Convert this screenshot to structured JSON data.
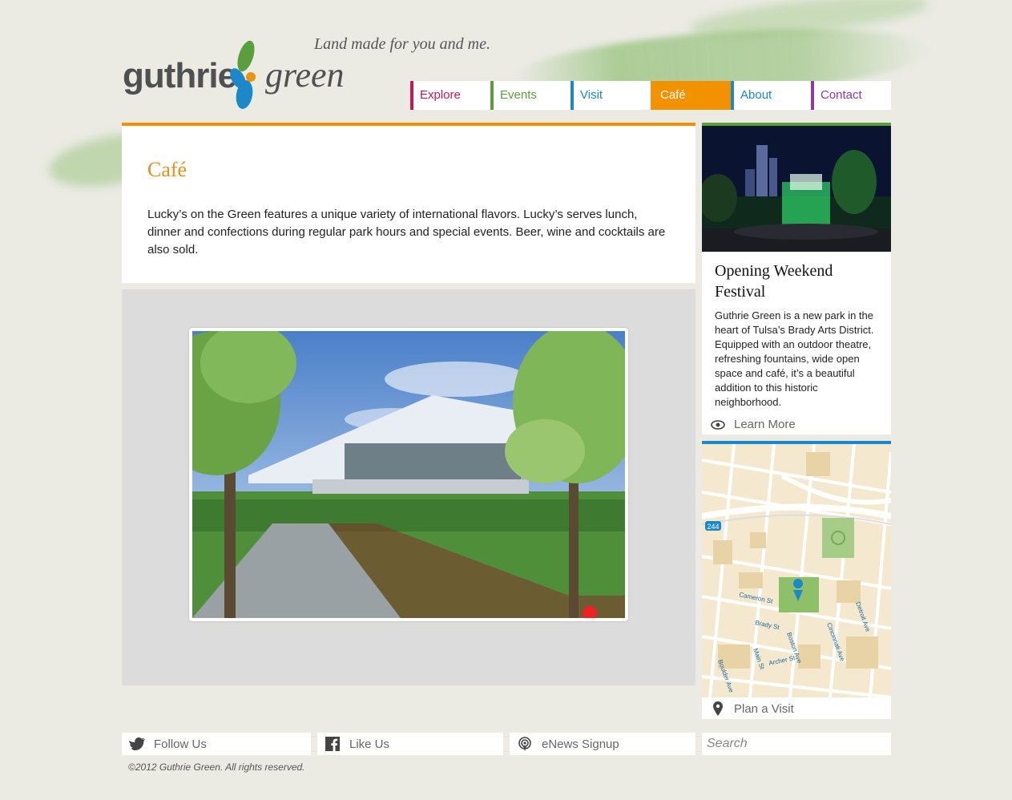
{
  "header": {
    "logo_word1": "guthrie",
    "logo_word2": "green",
    "tagline": "Land made for you and me."
  },
  "nav": {
    "explore": "Explore",
    "events": "Events",
    "visit": "Visit",
    "cafe": "Café",
    "about": "About",
    "contact": "Contact",
    "active": "Café"
  },
  "main": {
    "title": "Café",
    "intro": "Lucky’s on the Green features a unique variety of international flavors. Lucky’s serves lunch, dinner and confections during regular park hours and special events. Beer, wine and cocktails are also sold."
  },
  "sidebar": {
    "feature_title": "Opening Weekend Festival",
    "feature_text": "Guthrie Green is a new park in the heart of Tulsa’s Brady Arts District. Equipped with an outdoor theatre, refreshing fountains, wide open space and café, it’s a beautiful addition to this historic neighborhood.",
    "learn_more": "Learn More",
    "plan_visit": "Plan a Visit",
    "map_labels": {
      "hwy": "244",
      "cameron": "Cameron St",
      "brady": "Brady St",
      "main": "Main St",
      "boston": "Boston Ave",
      "archer": "Archer St",
      "boulder": "Boulder Ave",
      "cincinnati": "Cincinnati Ave",
      "detroit": "Detroit Ave"
    }
  },
  "footer": {
    "follow": "Follow Us",
    "like": "Like Us",
    "enews": "eNews Signup",
    "search_placeholder": "Search",
    "copyright": "©2012 Guthrie Green. All rights reserved."
  },
  "colors": {
    "accent_cafe": "#f39200",
    "green": "#5a9f3c",
    "blue": "#1a88c9",
    "magenta": "#c2185b",
    "purple": "#8e3a9e"
  }
}
